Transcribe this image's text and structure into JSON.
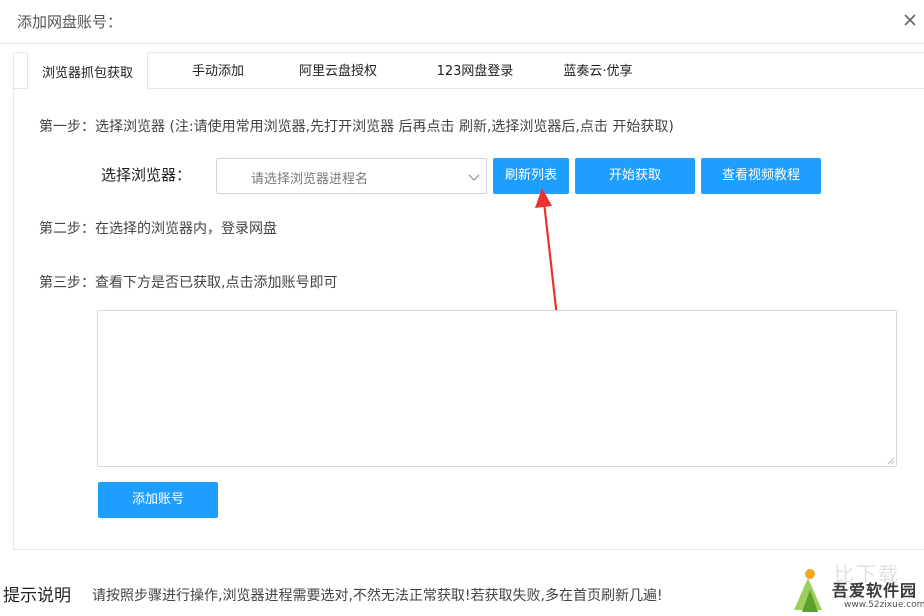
{
  "window": {
    "title": "添加网盘账号："
  },
  "tabs": [
    {
      "label": "浏览器抓包获取",
      "active": true
    },
    {
      "label": "手动添加",
      "active": false
    },
    {
      "label": "阿里云盘授权",
      "active": false
    },
    {
      "label": "123网盘登录",
      "active": false
    },
    {
      "label": "蓝奏云·优享",
      "active": false
    }
  ],
  "steps": {
    "step1": "第一步：选择浏览器 (注:请使用常用浏览器,先打开浏览器 后再点击 刷新,选择浏览器后,点击 开始获取)",
    "step2": "第二步：在选择的浏览器内，登录网盘",
    "step3": "第三步：查看下方是否已获取,点击添加账号即可"
  },
  "browser_select": {
    "label": "选择浏览器：",
    "placeholder": "请选择浏览器进程名"
  },
  "buttons": {
    "refresh": "刷新列表",
    "start": "开始获取",
    "tutorial": "查看视频教程",
    "add_account": "添加账号"
  },
  "result_box": {
    "value": ""
  },
  "tips": {
    "label": "提示说明",
    "text": "请按照步骤进行操作,浏览器进程需要选对,不然无法正常获取!若获取失败,多在首页刷新几遍!"
  },
  "watermark": {
    "brand": "吾爱软件园",
    "url": "www.52zixue.com",
    "faint_text": "比下载"
  },
  "colors": {
    "primary_button": "#1e9fff",
    "annotation_arrow": "#e8322e"
  },
  "icons": {
    "close": "close-icon",
    "dropdown": "chevron-down-icon",
    "arrow": "red-arrow-annotation"
  }
}
